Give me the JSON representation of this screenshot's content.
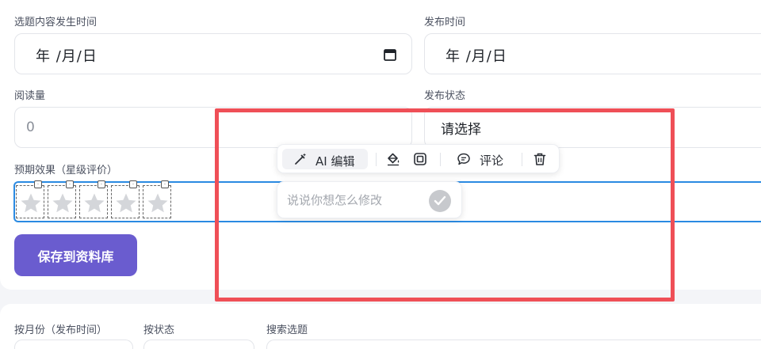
{
  "form": {
    "occur_time": {
      "label": "选题内容发生时间",
      "value": "年 /月/日"
    },
    "publish_time": {
      "label": "发布时间",
      "value": "年 /月/日"
    },
    "read_count": {
      "label": "阅读量",
      "value": "0"
    },
    "publish_status": {
      "label": "发布状态",
      "value": "请选择"
    },
    "rating": {
      "label": "预期效果（星级评价）",
      "stars": 5,
      "value": 0
    },
    "save_label": "保存到资料库"
  },
  "filters": {
    "by_month": "按月份（发布时间）",
    "by_status": "按状态",
    "search": "搜索选题"
  },
  "ai_toolbar": {
    "ai_edit_label": "AI 编辑",
    "comment_label": "评论",
    "prompt_placeholder": "说说你想怎么修改"
  },
  "colors": {
    "accent": "#6a5ccf",
    "focus": "#2a8ae2",
    "highlight": "#ef4f57"
  }
}
